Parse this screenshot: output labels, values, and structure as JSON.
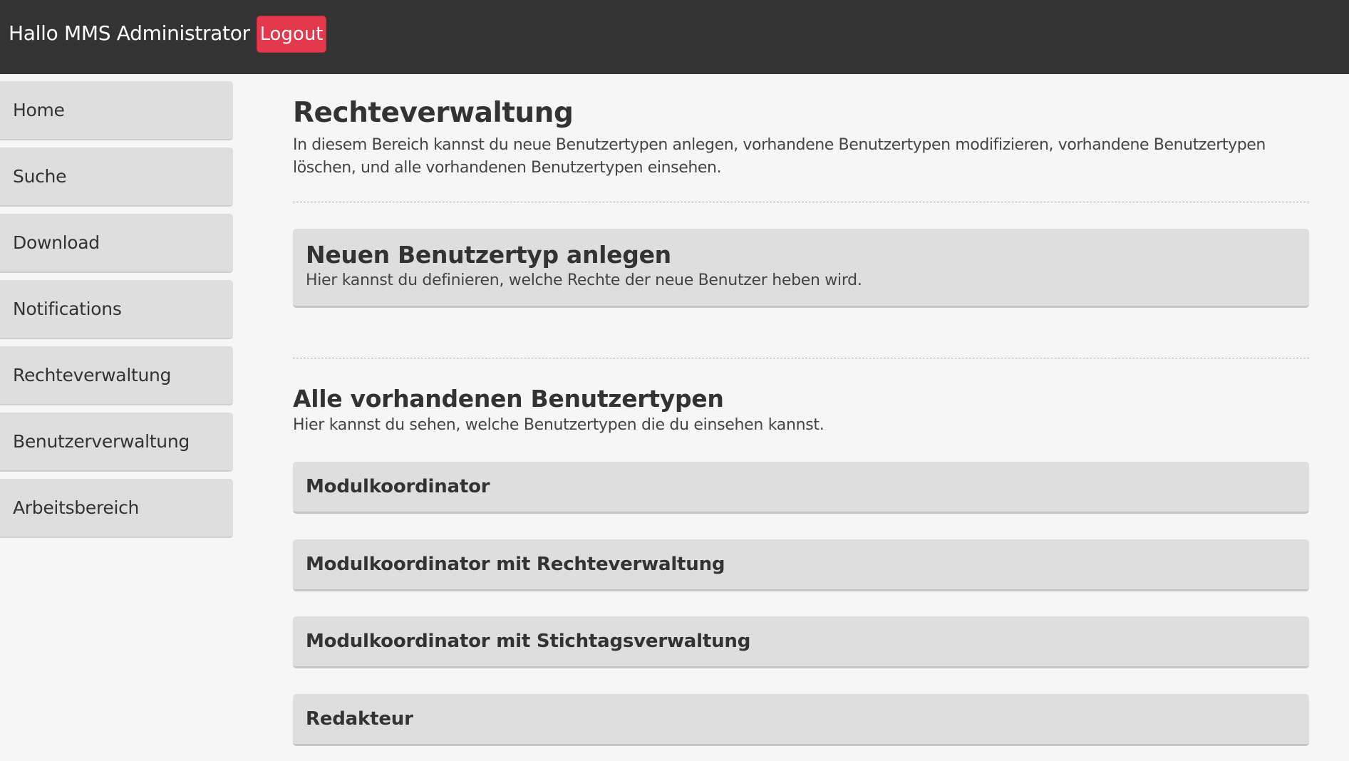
{
  "header": {
    "greeting": "Hallo MMS Administrator",
    "logout_label": "Logout"
  },
  "sidebar": {
    "items": [
      {
        "label": "Home"
      },
      {
        "label": "Suche"
      },
      {
        "label": "Download"
      },
      {
        "label": "Notifications"
      },
      {
        "label": "Rechteverwaltung"
      },
      {
        "label": "Benutzerverwaltung"
      },
      {
        "label": "Arbeitsbereich"
      }
    ]
  },
  "main": {
    "title": "Rechteverwaltung",
    "description": "In diesem Bereich kannst du neue Benutzertypen anlegen, vorhandene Benutzertypen modifizieren, vorhandene Benutzertypen löschen, und alle vorhandenen Benutzertypen einsehen.",
    "create": {
      "title": "Neuen Benutzertyp anlegen",
      "description": "Hier kannst du definieren, welche Rechte der neue Benutzer heben wird."
    },
    "existing": {
      "title": "Alle vorhandenen Benutzertypen",
      "description": "Hier kannst du sehen, welche Benutzertypen die du einsehen kannst.",
      "types": [
        {
          "label": "Modulkoordinator"
        },
        {
          "label": "Modulkoordinator mit Rechteverwaltung"
        },
        {
          "label": "Modulkoordinator mit Stichtagsverwaltung"
        },
        {
          "label": "Redakteur"
        }
      ]
    }
  },
  "colors": {
    "topbar": "#333333",
    "logout_button": "#e4384d",
    "page_background": "#f6f6f6",
    "panel_background": "#dedede"
  }
}
